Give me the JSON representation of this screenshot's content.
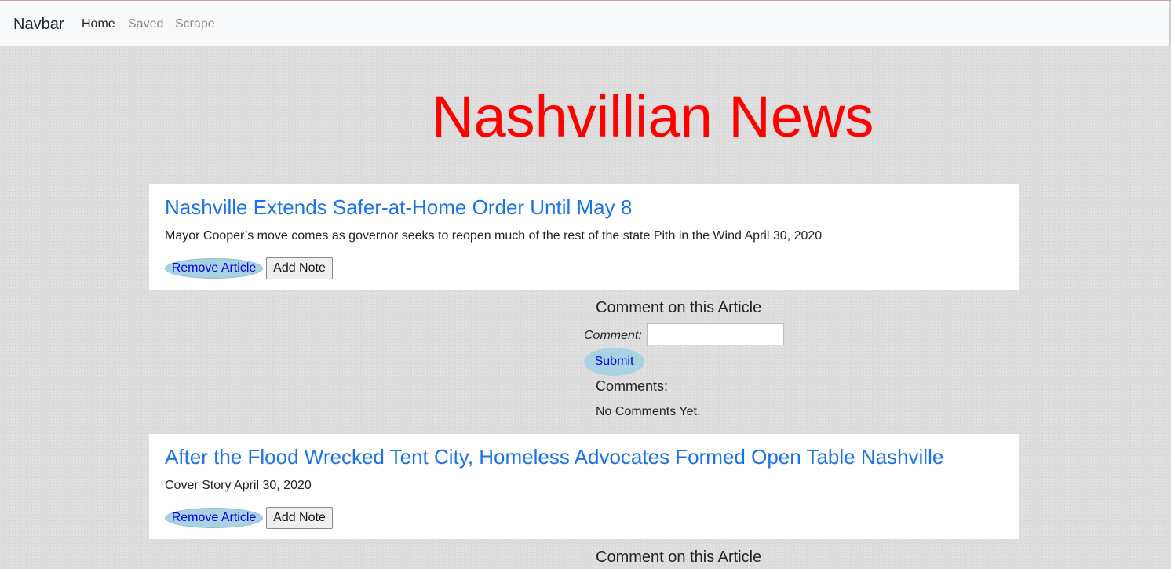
{
  "navbar": {
    "brand": "Navbar",
    "links": [
      {
        "label": "Home",
        "active": true
      },
      {
        "label": "Saved",
        "active": false
      },
      {
        "label": "Scrape",
        "active": false
      }
    ]
  },
  "page": {
    "title": "Nashvillian News",
    "title_color": "#ff0000"
  },
  "articles": [
    {
      "title": "Nashville Extends Safer-at-Home Order Until May 8",
      "summary": "Mayor Cooper’s move comes as governor seeks to reopen much of the rest of the state Pith in the Wind April 30, 2020",
      "remove_label": "Remove Article",
      "note_label": "Add Note"
    },
    {
      "title": "After the Flood Wrecked Tent City, Homeless Advocates Formed Open Table Nashville",
      "summary": "Cover Story April 30, 2020",
      "remove_label": "Remove Article",
      "note_label": "Add Note"
    }
  ],
  "comment_section": {
    "heading": "Comment on this Article",
    "comment_label": "Comment:",
    "comment_value": "",
    "submit_label": "Submit",
    "comments_heading": "Comments:",
    "no_comments": "No Comments Yet."
  },
  "colors": {
    "link": "#1a73e8",
    "button_bg": "#a9d3e3",
    "button_text": "#0000ee"
  }
}
